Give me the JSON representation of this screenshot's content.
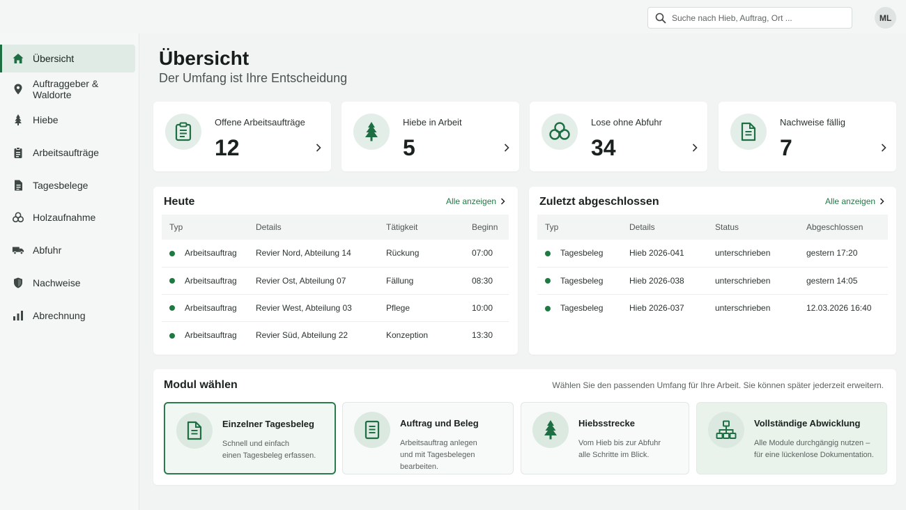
{
  "search": {
    "placeholder": "Suche nach Hieb, Auftrag, Ort ..."
  },
  "user": {
    "initials": "ML"
  },
  "colors": {
    "accent": "#1e6e43",
    "accent_light": "#e4eee8",
    "background": "#f2f4f3"
  },
  "sidebar": {
    "items": [
      {
        "label": "Übersicht",
        "icon": "home-icon",
        "active": true
      },
      {
        "label": "Auftraggeber & Waldorte",
        "icon": "location-pin-icon"
      },
      {
        "label": "Hiebe",
        "icon": "tree-icon"
      },
      {
        "label": "Arbeitsaufträge",
        "icon": "clipboard-icon"
      },
      {
        "label": "Tagesbelege",
        "icon": "document-icon"
      },
      {
        "label": "Holzaufnahme",
        "icon": "log-stack-icon"
      },
      {
        "label": "Abfuhr",
        "icon": "truck-icon"
      },
      {
        "label": "Nachweise",
        "icon": "shield-icon"
      },
      {
        "label": "Abrechnung",
        "icon": "bar-chart-icon"
      }
    ]
  },
  "page": {
    "title": "Übersicht",
    "subtitle": "Der Umfang ist Ihre Entscheidung"
  },
  "stats": [
    {
      "label": "Offene Arbeitsaufträge",
      "value": "12",
      "icon": "clipboard-icon"
    },
    {
      "label": "Hiebe in Arbeit",
      "value": "5",
      "icon": "tree-icon"
    },
    {
      "label": "Lose ohne Abfuhr",
      "value": "34",
      "icon": "log-stack-icon"
    },
    {
      "label": "Nachweise fällig",
      "value": "7",
      "icon": "document-icon"
    }
  ],
  "today": {
    "title": "Heute",
    "link": "Alle anzeigen",
    "columns": [
      "Typ",
      "Details",
      "Tätigkeit",
      "Beginn"
    ],
    "rows": [
      [
        "Arbeitsauftrag",
        "Revier Nord, Abteilung 14",
        "Rückung",
        "07:00"
      ],
      [
        "Arbeitsauftrag",
        "Revier Ost, Abteilung 07",
        "Fällung",
        "08:30"
      ],
      [
        "Arbeitsauftrag",
        "Revier West, Abteilung 03",
        "Pflege",
        "10:00"
      ],
      [
        "Arbeitsauftrag",
        "Revier Süd, Abteilung 22",
        "Konzeption",
        "13:30"
      ]
    ]
  },
  "recent": {
    "title": "Zuletzt abgeschlossen",
    "link": "Alle anzeigen",
    "columns": [
      "Typ",
      "Details",
      "Status",
      "Abgeschlossen"
    ],
    "rows": [
      [
        "Tagesbeleg",
        "Hieb 2026-041",
        "unterschrieben",
        "gestern 17:20"
      ],
      [
        "Tagesbeleg",
        "Hieb 2026-038",
        "unterschrieben",
        "gestern 14:05"
      ],
      [
        "Tagesbeleg",
        "Hieb 2026-037",
        "unterschrieben",
        "12.03.2026 16:40"
      ]
    ]
  },
  "modules": {
    "title": "Modul wählen",
    "hint": "Wählen Sie den passenden Umfang für Ihre Arbeit. Sie können später jederzeit erweitern.",
    "items": [
      {
        "name": "Einzelner Tagesbeleg",
        "desc": "Schnell und einfach\neinen Tagesbeleg erfassen.",
        "icon": "document-icon",
        "selected": true
      },
      {
        "name": "Auftrag und Beleg",
        "desc": "Arbeitsauftrag anlegen\nund mit Tagesbelegen bearbeiten.",
        "icon": "notepad-icon"
      },
      {
        "name": "Hiebsstrecke",
        "desc": "Vom Hieb bis zur Abfuhr\nalle Schritte im Blick.",
        "icon": "tree-icon"
      },
      {
        "name": "Vollständige Abwicklung",
        "desc": "Alle Module durchgängig nutzen –\nfür eine lückenlose Dokumentation.",
        "icon": "hierarchy-icon"
      }
    ]
  }
}
